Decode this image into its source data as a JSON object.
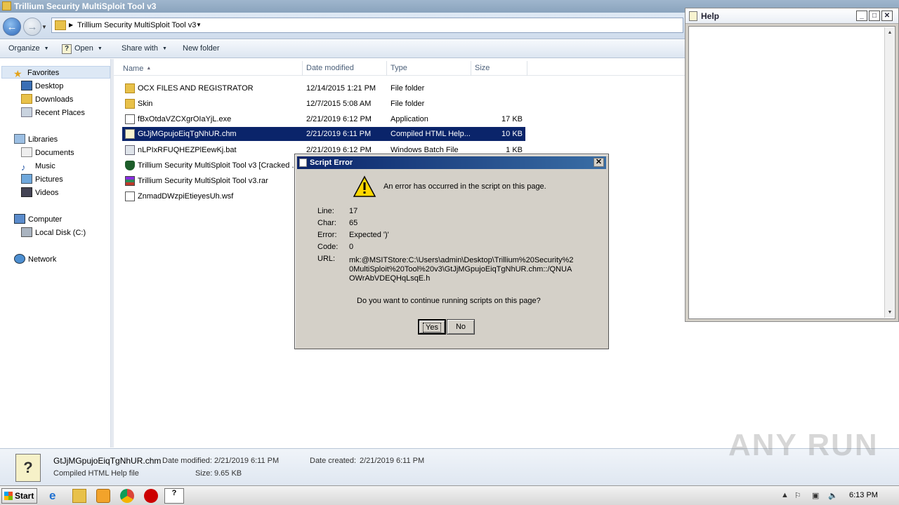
{
  "explorer": {
    "title": "Trillium Security MultiSploit Tool v3",
    "address": "Trillium Security MultiSploit Tool v3",
    "toolbar": {
      "organize": "Organize",
      "open": "Open",
      "share_with": "Share with",
      "new_folder": "New folder"
    },
    "nav": {
      "favorites": "Favorites",
      "desktop": "Desktop",
      "downloads": "Downloads",
      "recent_places": "Recent Places",
      "libraries": "Libraries",
      "documents": "Documents",
      "music": "Music",
      "pictures": "Pictures",
      "videos": "Videos",
      "computer": "Computer",
      "local_disk": "Local Disk (C:)",
      "network": "Network"
    },
    "columns": {
      "name": "Name",
      "date": "Date modified",
      "type": "Type",
      "size": "Size"
    },
    "files": [
      {
        "name": "OCX FILES AND REGISTRATOR",
        "date": "12/14/2015 1:21 PM",
        "type": "File folder",
        "size": ""
      },
      {
        "name": "Skin",
        "date": "12/7/2015 5:08 AM",
        "type": "File folder",
        "size": ""
      },
      {
        "name": "fBxOtdaVZCXgrOIaYjL.exe",
        "date": "2/21/2019 6:12 PM",
        "type": "Application",
        "size": "17 KB"
      },
      {
        "name": "GtJjMGpujoEiqTgNhUR.chm",
        "date": "2/21/2019 6:11 PM",
        "type": "Compiled HTML Help...",
        "size": "10 KB"
      },
      {
        "name": "nLPIxRFUQHEZPlEewKj.bat",
        "date": "2/21/2019 6:12 PM",
        "type": "Windows Batch File",
        "size": "1 KB"
      },
      {
        "name": "Trillium Security MultiSploit Tool v3 [Cracked ...",
        "date": "",
        "type": "",
        "size": ""
      },
      {
        "name": "Trillium Security MultiSploit Tool v3.rar",
        "date": "",
        "type": "",
        "size": ""
      },
      {
        "name": "ZnmadDWzpiEtieyesUh.wsf",
        "date": "",
        "type": "",
        "size": ""
      }
    ],
    "details": {
      "filename": "GtJjMGpujoEiqTgNhUR.chm",
      "filetype": "Compiled HTML Help file",
      "date_modified_label": "Date modified:",
      "date_modified": "2/21/2019 6:11 PM",
      "date_created_label": "Date created:",
      "date_created": "2/21/2019 6:11 PM",
      "size_label": "Size:",
      "size": "9.65 KB"
    }
  },
  "help_window": {
    "title": "Help"
  },
  "dialog": {
    "title": "Script Error",
    "message": "An error has occurred in the script on this page.",
    "line_label": "Line:",
    "line": "17",
    "char_label": "Char:",
    "char": "65",
    "error_label": "Error:",
    "error": "Expected ')'",
    "code_label": "Code:",
    "code": "0",
    "url_label": "URL:",
    "url": "mk:@MSITStore:C:\\Users\\admin\\Desktop\\Trillium%20Security%20MultiSploit%20Tool%20v3\\GtJjMGpujoEiqTgNhUR.chm::/QNUAOWrAbVDEQHqLsqE.h",
    "question": "Do you want to continue running scripts on this page?",
    "yes": "Yes",
    "no": "No"
  },
  "taskbar": {
    "start": "Start",
    "time": "6:13 PM"
  },
  "watermark": "ANY RUN"
}
